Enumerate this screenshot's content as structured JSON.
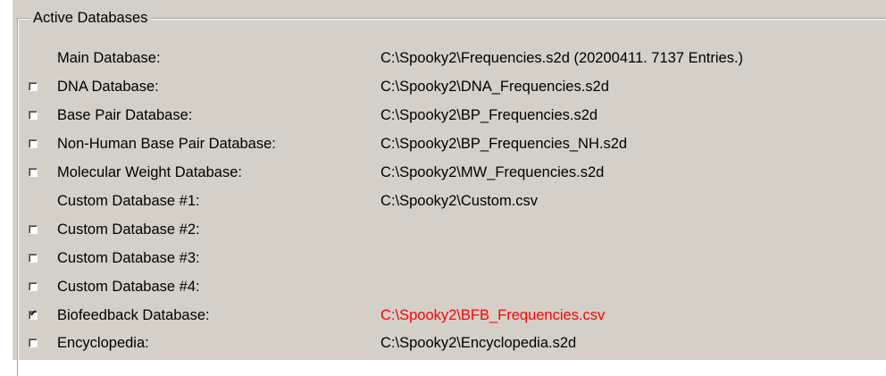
{
  "group": {
    "title": "Active Databases"
  },
  "rows": [
    {
      "label": "Main Database:",
      "path": "C:\\Spooky2\\Frequencies.s2d  (20200411. 7137 Entries.)"
    },
    {
      "label": "DNA Database:",
      "path": "C:\\Spooky2\\DNA_Frequencies.s2d"
    },
    {
      "label": "Base Pair Database:",
      "path": "C:\\Spooky2\\BP_Frequencies.s2d"
    },
    {
      "label": "Non-Human Base Pair Database:",
      "path": "C:\\Spooky2\\BP_Frequencies_NH.s2d"
    },
    {
      "label": "Molecular Weight Database:",
      "path": "C:\\Spooky2\\MW_Frequencies.s2d"
    },
    {
      "label": "Custom Database #1:",
      "path": "C:\\Spooky2\\Custom.csv"
    },
    {
      "label": "Custom Database #2:",
      "path": ""
    },
    {
      "label": "Custom Database #3:",
      "path": ""
    },
    {
      "label": "Custom Database #4:",
      "path": ""
    },
    {
      "label": "Biofeedback Database:",
      "path": "C:\\Spooky2\\BFB_Frequencies.csv"
    },
    {
      "label": "Encyclopedia:",
      "path": "C:\\Spooky2\\Encyclopedia.s2d"
    }
  ],
  "checkboxes": {
    "dna": {
      "checked": false
    },
    "base_pair": {
      "checked": false
    },
    "non_human_base_pair": {
      "checked": false
    },
    "molecular_weight": {
      "checked": false
    },
    "custom_2": {
      "checked": false
    },
    "custom_3": {
      "checked": false
    },
    "custom_4": {
      "checked": false
    },
    "biofeedback": {
      "checked": true,
      "mark": "✔"
    },
    "encyclopedia": {
      "checked": false
    }
  },
  "colors": {
    "panel_background": "#d4d0c8",
    "highlight_path": "#ff0000"
  }
}
